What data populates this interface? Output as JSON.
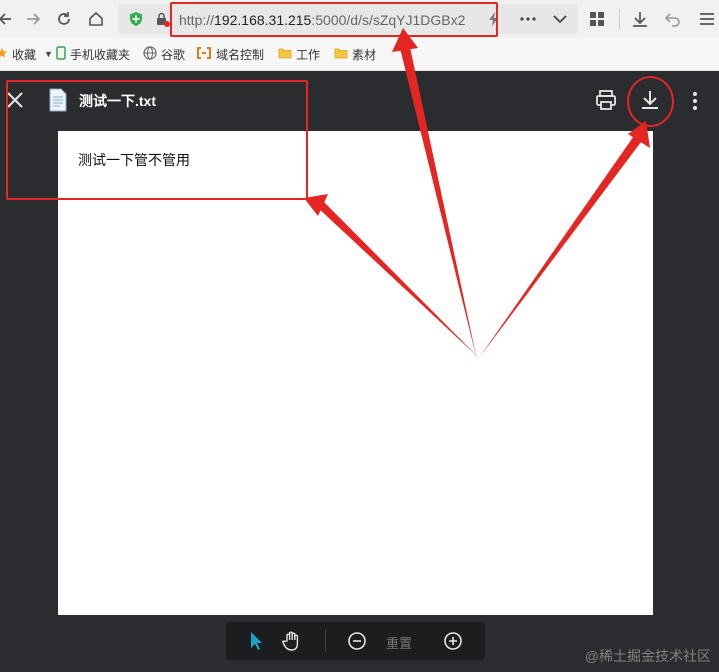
{
  "browser": {
    "url_prefix": "http://",
    "url_host": "192.168.31.215",
    "url_rest": ":5000/d/s/sZqYJ1DGBx2"
  },
  "bookmarks": [
    {
      "label": "收藏",
      "icon": "star-icon"
    },
    {
      "label": "手机收藏夹",
      "icon": "phone-icon"
    },
    {
      "label": "谷歌",
      "icon": "globe-icon"
    },
    {
      "label": "域名控制",
      "icon": "domain-icon"
    },
    {
      "label": "工作",
      "icon": "folder-icon"
    },
    {
      "label": "素材",
      "icon": "folder-icon"
    }
  ],
  "viewer": {
    "file_name": "测试一下.txt",
    "content": "测试一下管不管用",
    "reset_label": "重置"
  },
  "watermark": "@稀土掘金技术社区",
  "colors": {
    "annotation": "#e52521",
    "viewer_bg": "#2b2c2f",
    "accent_cursor": "#1aa1c8"
  }
}
